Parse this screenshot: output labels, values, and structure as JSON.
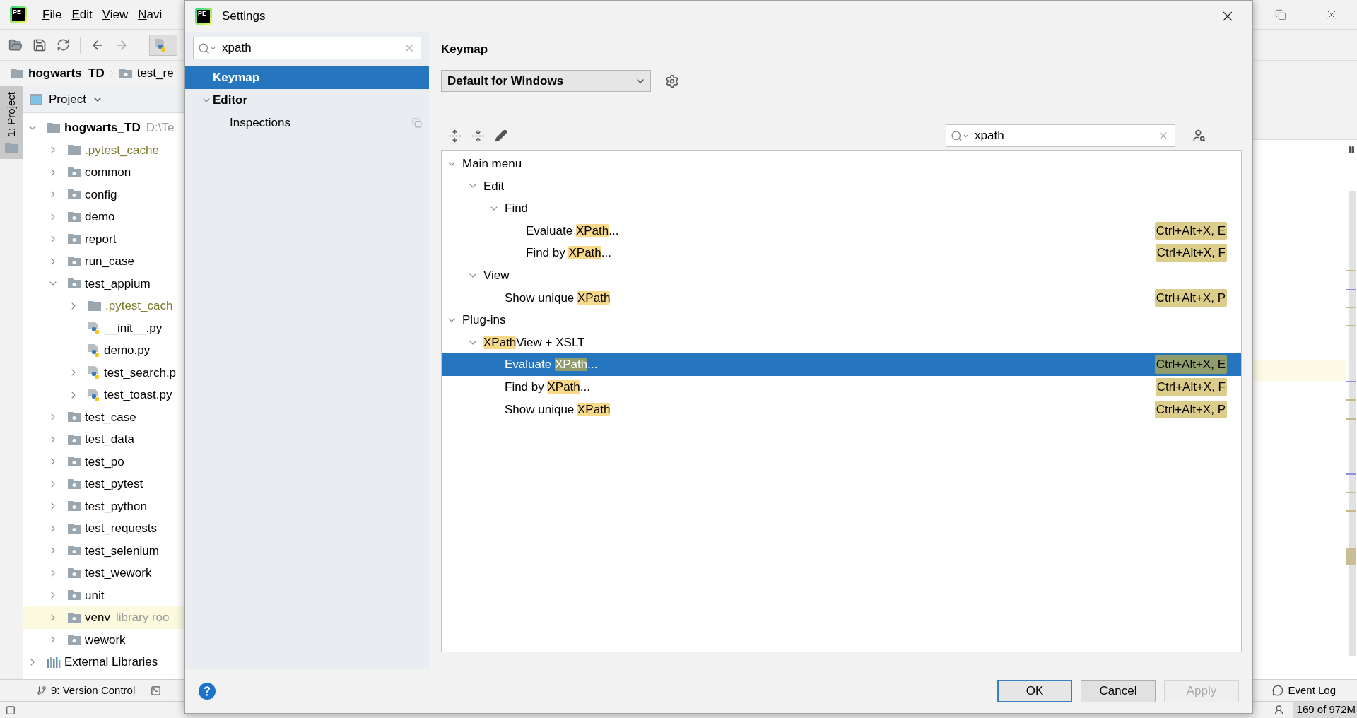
{
  "ide": {
    "logo": "PE",
    "menu": [
      "File",
      "Edit",
      "View",
      "Navi"
    ],
    "breadcrumb": [
      {
        "label": "hogwarts_TD",
        "kind": "project"
      },
      {
        "label": "test_re",
        "kind": "folder"
      }
    ],
    "side_tab": {
      "label": "1: Project",
      "selected": true
    },
    "project_panel": {
      "title": "Project",
      "tree": [
        {
          "label": "hogwarts_TD",
          "kind": "project",
          "hint": "D:\\Te",
          "expanded": true,
          "highlighted": false,
          "children": [
            {
              "label": ".pytest_cache",
              "kind": "excluded",
              "expanded": false,
              "highlighted": false
            },
            {
              "label": "common",
              "kind": "folder",
              "expanded": false,
              "highlighted": false
            },
            {
              "label": "config",
              "kind": "folder",
              "expanded": false,
              "highlighted": false
            },
            {
              "label": "demo",
              "kind": "folder",
              "expanded": false,
              "highlighted": false
            },
            {
              "label": "report",
              "kind": "folder",
              "expanded": false,
              "highlighted": false
            },
            {
              "label": "run_case",
              "kind": "folder",
              "expanded": false,
              "highlighted": false
            },
            {
              "label": "test_appium",
              "kind": "folder",
              "expanded": true,
              "highlighted": false,
              "children": [
                {
                  "label": ".pytest_cach",
                  "kind": "excluded",
                  "expanded": false,
                  "highlighted": false
                },
                {
                  "label": "__init__.py",
                  "kind": "python",
                  "highlighted": false
                },
                {
                  "label": "demo.py",
                  "kind": "python",
                  "highlighted": false
                },
                {
                  "label": "test_search.p",
                  "kind": "python",
                  "expanded": false,
                  "highlighted": false
                },
                {
                  "label": "test_toast.py",
                  "kind": "python",
                  "expanded": false,
                  "highlighted": false
                }
              ]
            },
            {
              "label": "test_case",
              "kind": "folder",
              "expanded": false,
              "highlighted": false
            },
            {
              "label": "test_data",
              "kind": "folder",
              "expanded": false,
              "highlighted": false
            },
            {
              "label": "test_po",
              "kind": "folder",
              "expanded": false,
              "highlighted": false
            },
            {
              "label": "test_pytest",
              "kind": "folder",
              "expanded": false,
              "highlighted": false
            },
            {
              "label": "test_python",
              "kind": "folder",
              "expanded": false,
              "highlighted": false
            },
            {
              "label": "test_requests",
              "kind": "folder",
              "expanded": false,
              "highlighted": false
            },
            {
              "label": "test_selenium",
              "kind": "folder",
              "expanded": false,
              "highlighted": false
            },
            {
              "label": "test_wework",
              "kind": "folder",
              "expanded": false,
              "highlighted": false
            },
            {
              "label": "unit",
              "kind": "folder",
              "expanded": false,
              "highlighted": false
            },
            {
              "label": "venv",
              "kind": "folder",
              "hint": "library roo",
              "expanded": false,
              "highlighted": true
            },
            {
              "label": "wework",
              "kind": "folder",
              "expanded": false,
              "highlighted": false
            }
          ]
        },
        {
          "label": "External Libraries",
          "kind": "libraries",
          "expanded": false,
          "highlighted": false
        }
      ]
    },
    "bottom_tab": "9: Version Control",
    "event_log": "Event Log",
    "memory": "169 of 972M"
  },
  "dialog": {
    "logo": "PE",
    "title": "Settings",
    "search": {
      "value": "xpath"
    },
    "nav": [
      {
        "label": "Keymap",
        "selected": true
      },
      {
        "label": "Editor",
        "selected": false,
        "expanded": true,
        "children": [
          {
            "label": "Inspections",
            "selected": false,
            "project_scoped": true
          }
        ]
      }
    ],
    "header": "Keymap",
    "keymap_select": "Default for Windows",
    "filter": {
      "value": "xpath"
    },
    "tree": [
      {
        "label": [
          {
            "text": "Main menu",
            "match": false
          }
        ],
        "expanded": true,
        "selected": false,
        "children": [
          {
            "label": [
              {
                "text": "Edit",
                "match": false
              }
            ],
            "expanded": true,
            "selected": false,
            "children": [
              {
                "label": [
                  {
                    "text": "Find",
                    "match": false
                  }
                ],
                "expanded": true,
                "selected": false,
                "children": [
                  {
                    "label": [
                      {
                        "text": "Evaluate ",
                        "match": false
                      },
                      {
                        "text": "XPath",
                        "match": true
                      },
                      {
                        "text": "...",
                        "match": false
                      }
                    ],
                    "shortcut": "Ctrl+Alt+X, E",
                    "selected": false
                  },
                  {
                    "label": [
                      {
                        "text": "Find by ",
                        "match": false
                      },
                      {
                        "text": "XPath",
                        "match": true
                      },
                      {
                        "text": "...",
                        "match": false
                      }
                    ],
                    "shortcut": "Ctrl+Alt+X, F",
                    "selected": false
                  }
                ]
              }
            ]
          },
          {
            "label": [
              {
                "text": "View",
                "match": false
              }
            ],
            "expanded": true,
            "selected": false,
            "children": [
              {
                "label": [
                  {
                    "text": "Show unique ",
                    "match": false
                  },
                  {
                    "text": "XPath",
                    "match": true
                  }
                ],
                "shortcut": "Ctrl+Alt+X, P",
                "selected": false
              }
            ]
          }
        ]
      },
      {
        "label": [
          {
            "text": "Plug-ins",
            "match": false
          }
        ],
        "expanded": true,
        "selected": false,
        "children": [
          {
            "label": [
              {
                "text": "XPath",
                "match": true
              },
              {
                "text": "View + XSLT",
                "match": false
              }
            ],
            "expanded": true,
            "selected": false,
            "children": [
              {
                "label": [
                  {
                    "text": "Evaluate ",
                    "match": false
                  },
                  {
                    "text": "XPath",
                    "match": true
                  },
                  {
                    "text": "...",
                    "match": false
                  }
                ],
                "shortcut": "Ctrl+Alt+X, E",
                "selected": true
              },
              {
                "label": [
                  {
                    "text": "Find by ",
                    "match": false
                  },
                  {
                    "text": "XPath",
                    "match": true
                  },
                  {
                    "text": "...",
                    "match": false
                  }
                ],
                "shortcut": "Ctrl+Alt+X, F",
                "selected": false
              },
              {
                "label": [
                  {
                    "text": "Show unique ",
                    "match": false
                  },
                  {
                    "text": "XPath",
                    "match": true
                  }
                ],
                "shortcut": "Ctrl+Alt+X, P",
                "selected": false
              }
            ]
          }
        ]
      }
    ],
    "buttons": [
      {
        "label": "OK",
        "default": true,
        "disabled": false
      },
      {
        "label": "Cancel",
        "default": false,
        "disabled": false
      },
      {
        "label": "Apply",
        "default": false,
        "disabled": true
      }
    ]
  }
}
